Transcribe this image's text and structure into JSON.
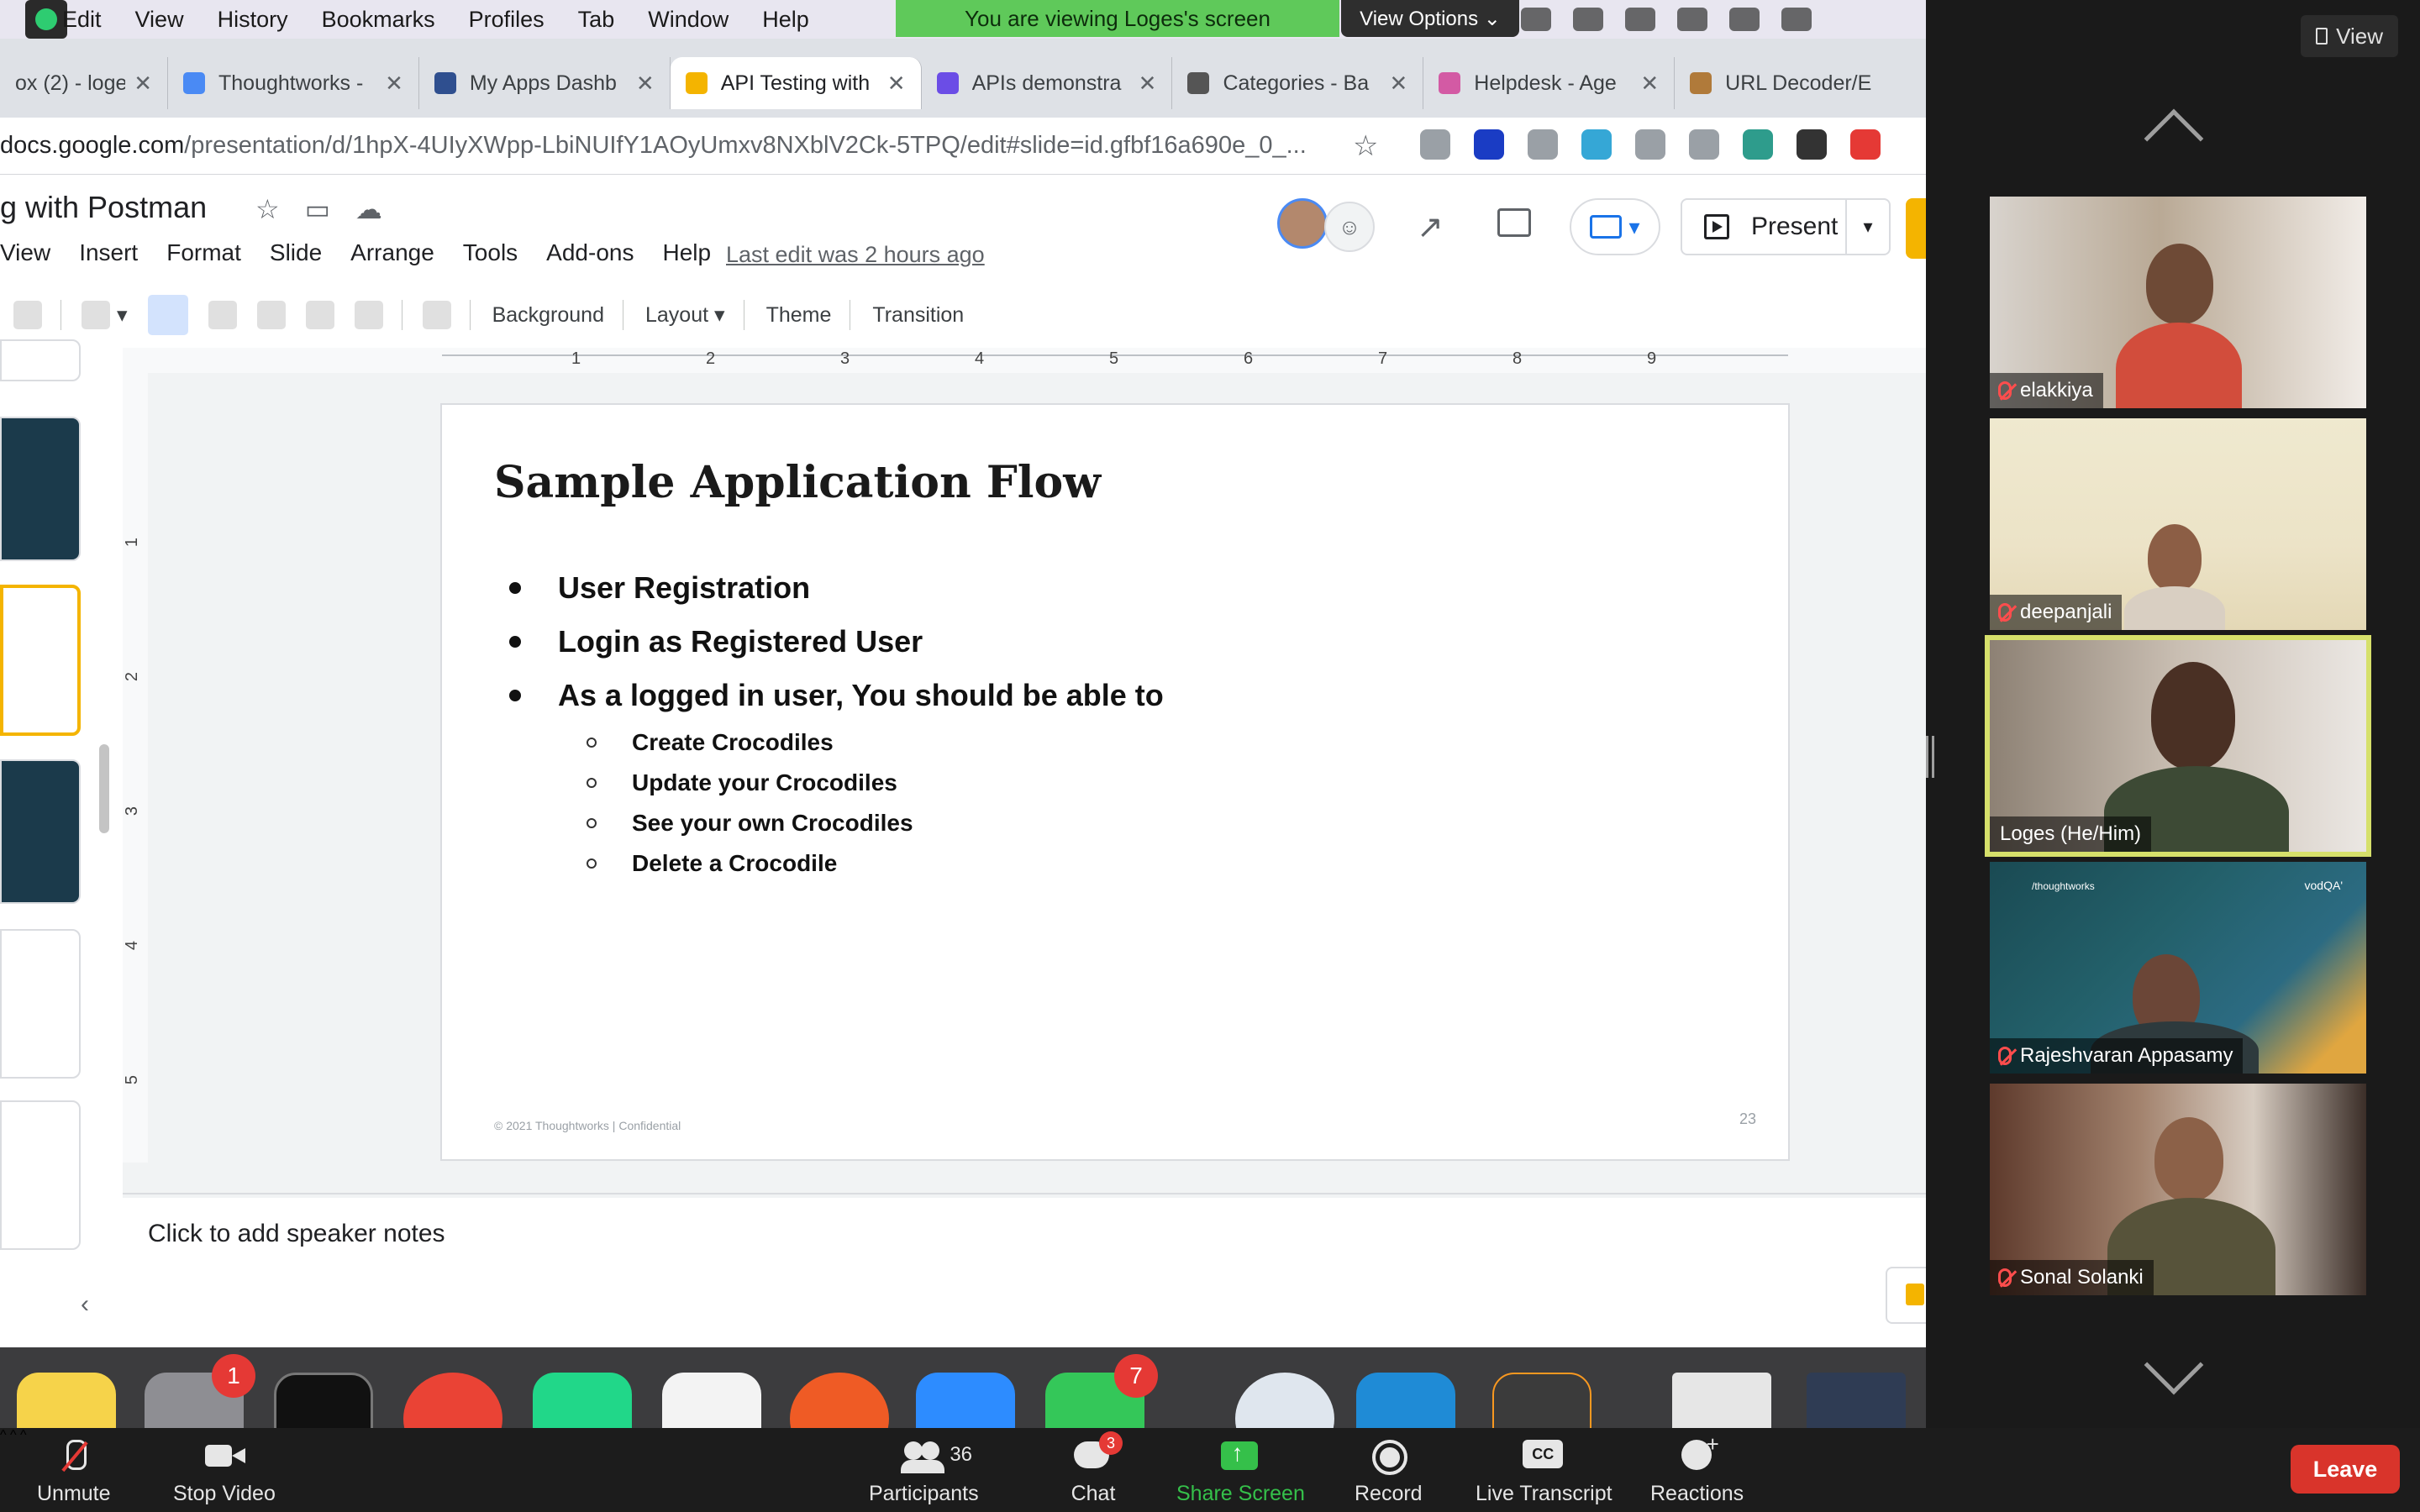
{
  "mac_menubar": {
    "items": [
      "Edit",
      "View",
      "History",
      "Bookmarks",
      "Profiles",
      "Tab",
      "Window",
      "Help"
    ],
    "viewing_banner": "You are viewing Loges's screen",
    "view_options": "View Options ⌄"
  },
  "browser": {
    "tabs": [
      {
        "label": "ox (2) - loge",
        "favicon_color": "#d93025"
      },
      {
        "label": "Thoughtworks -",
        "favicon_color": "#4a8af4"
      },
      {
        "label": "My Apps Dashb",
        "favicon_color": "#2f4f8f"
      },
      {
        "label": "API Testing with",
        "favicon_color": "#f4b400",
        "active": true
      },
      {
        "label": "APIs demonstra",
        "favicon_color": "#6b4de6"
      },
      {
        "label": "Categories - Ba",
        "favicon_color": "#555555"
      },
      {
        "label": "Helpdesk - Age",
        "favicon_color": "#d35aa4"
      },
      {
        "label": "URL Decoder/E",
        "favicon_color": "#b07a3a"
      }
    ],
    "url_host": "docs.google.com",
    "url_path": "/presentation/d/1hpX-4UIyXWpp-LbiNUIfY1AOyUmxv8NXblV2Ck-5TPQ/edit#slide=id.gfbf16a690e_0_..."
  },
  "slides_app": {
    "doc_title": "g with Postman",
    "menu": [
      "View",
      "Insert",
      "Format",
      "Slide",
      "Arrange",
      "Tools",
      "Add-ons",
      "Help"
    ],
    "last_edit": "Last edit was 2 hours ago",
    "present_label": "Present",
    "toolbar": {
      "background": "Background",
      "layout": "Layout ▾",
      "theme": "Theme",
      "transition": "Transition"
    },
    "ruler_h": [
      "1",
      "2",
      "3",
      "4",
      "5",
      "6",
      "7",
      "8",
      "9"
    ],
    "ruler_v": [
      "1",
      "2",
      "3",
      "4",
      "5"
    ],
    "speaker_notes_placeholder": "Click to add speaker notes"
  },
  "slide": {
    "title": "Sample Application Flow",
    "bullets": [
      "User Registration",
      "Login as Registered User",
      "As a logged in user, You should be able to"
    ],
    "sub_bullets": [
      "Create Crocodiles",
      "Update your Crocodiles",
      "See your own Crocodiles",
      "Delete a Crocodile"
    ],
    "footer": "© 2021 Thoughtworks  |  Confidential",
    "page_number": "23"
  },
  "dock": {
    "badges": {
      "system_prefs": "1",
      "messages": "7"
    }
  },
  "gallery": {
    "view_label": "View",
    "participants": [
      {
        "name": "elakkiya",
        "muted": true
      },
      {
        "name": "deepanjali",
        "muted": true
      },
      {
        "name": "Loges  (He/Him)",
        "muted": false,
        "active_speaker": true
      },
      {
        "name": "Rajeshvaran Appasamy",
        "muted": true,
        "tile_logo": "/thoughtworks",
        "tile_brand": "vodQA'"
      },
      {
        "name": "Sonal Solanki",
        "muted": true
      }
    ]
  },
  "zoom_controls": {
    "unmute": "Unmute",
    "stop_video": "Stop Video",
    "participants": "Participants",
    "participants_count": "36",
    "chat": "Chat",
    "chat_badge": "3",
    "share_screen": "Share Screen",
    "record": "Record",
    "live_transcript": "Live Transcript",
    "reactions": "Reactions",
    "leave": "Leave"
  },
  "colors": {
    "banner_green": "#5fc95a",
    "active_speaker_outline": "#d6e06b",
    "leave_red": "#d9342b",
    "share_green": "#35c04a",
    "slides_accent": "#f4b400"
  }
}
